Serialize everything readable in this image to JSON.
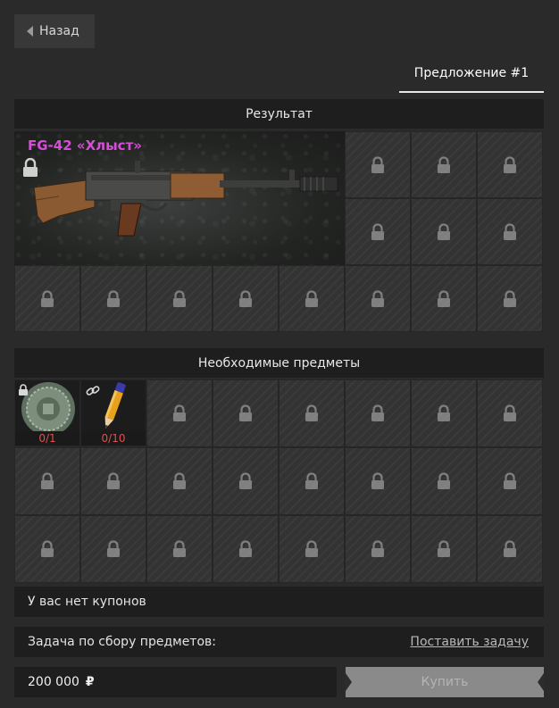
{
  "header": {
    "back_label": "Назад",
    "offer_tab_label": "Предложение #1"
  },
  "result": {
    "section_title": "Результат",
    "item_name": "FG-42 «Хлыст»",
    "item_name_color": "#d54fd6"
  },
  "required": {
    "section_title": "Необходимые предметы",
    "items": [
      {
        "icon": "coin-token-icon",
        "status_icon": "lock-icon",
        "count": "0/1"
      },
      {
        "icon": "pencil-icon",
        "status_icon": "link-icon",
        "count": "0/10"
      }
    ]
  },
  "coupons": {
    "text": "У вас нет купонов"
  },
  "task": {
    "label": "Задача по сбору предметов:",
    "link_label": "Поставить задачу"
  },
  "purchase": {
    "price": "200 000",
    "currency_symbol": "₽",
    "buy_label": "Купить"
  },
  "colors": {
    "background": "#2a2a2a",
    "panel": "#1e1e1e",
    "count_red": "#e05050"
  }
}
